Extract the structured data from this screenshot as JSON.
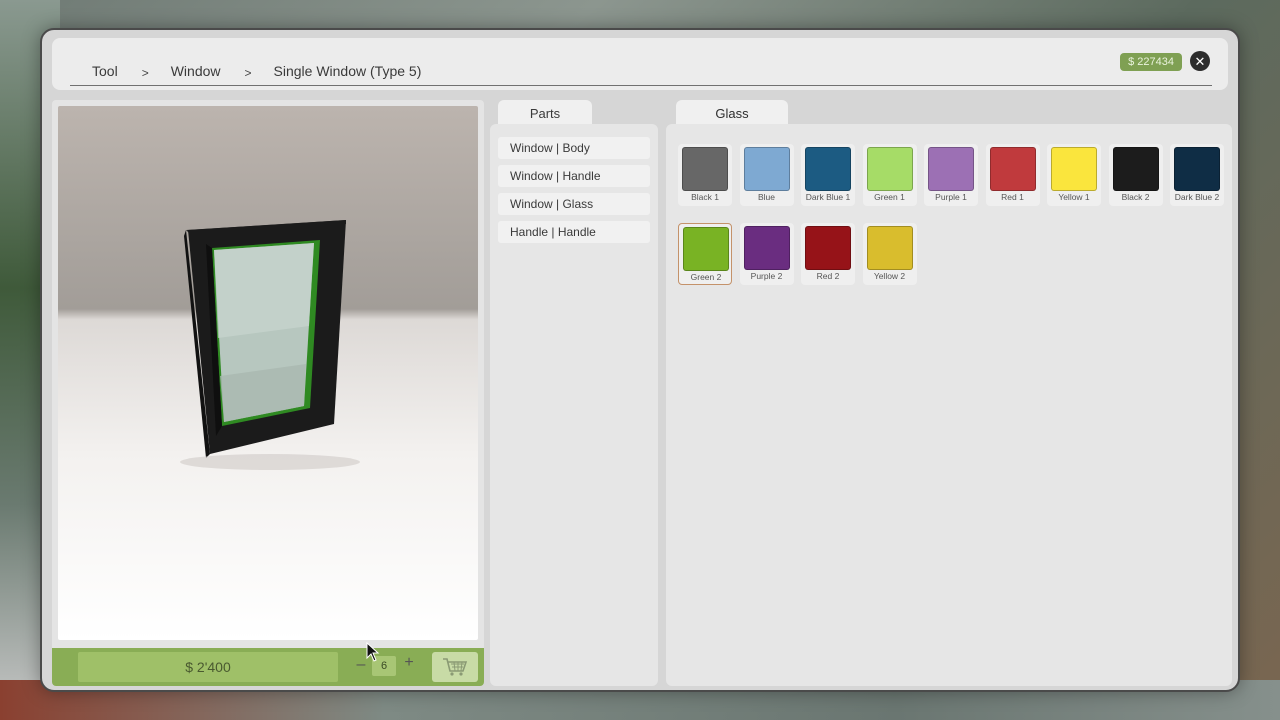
{
  "breadcrumb": {
    "items": [
      "Tool",
      "Window",
      "Single Window (Type 5)"
    ],
    "separator": ">"
  },
  "money": "$ 227434",
  "price": "$ 2'400",
  "quantity": "6",
  "parts": {
    "tab_label": "Parts",
    "items": [
      "Window | Body",
      "Window | Handle",
      "Window | Glass",
      "Handle | Handle"
    ]
  },
  "glass": {
    "tab_label": "Glass",
    "swatches": [
      {
        "label": "Black 1",
        "color": "#676767"
      },
      {
        "label": "Blue",
        "color": "#7ea9d2"
      },
      {
        "label": "Dark Blue 1",
        "color": "#1c5b82"
      },
      {
        "label": "Green 1",
        "color": "#a6dc67"
      },
      {
        "label": "Purple 1",
        "color": "#9c70b4"
      },
      {
        "label": "Red 1",
        "color": "#c03a3d"
      },
      {
        "label": "Yellow 1",
        "color": "#fae53d"
      },
      {
        "label": "Black 2",
        "color": "#1c1c1c"
      },
      {
        "label": "Dark Blue 2",
        "color": "#0f2d45"
      },
      {
        "label": "Green 2",
        "color": "#79b324"
      },
      {
        "label": "Purple 2",
        "color": "#6a2d80"
      },
      {
        "label": "Red 2",
        "color": "#961318"
      },
      {
        "label": "Yellow 2",
        "color": "#d9bd2d"
      }
    ],
    "selected": "Green 2"
  },
  "colors": {
    "accent_green": "#89ad55",
    "money_badge": "#7fa053"
  },
  "icons": {
    "close": "close-icon",
    "cart": "cart-icon",
    "minus": "minus-icon",
    "plus": "plus-icon"
  }
}
